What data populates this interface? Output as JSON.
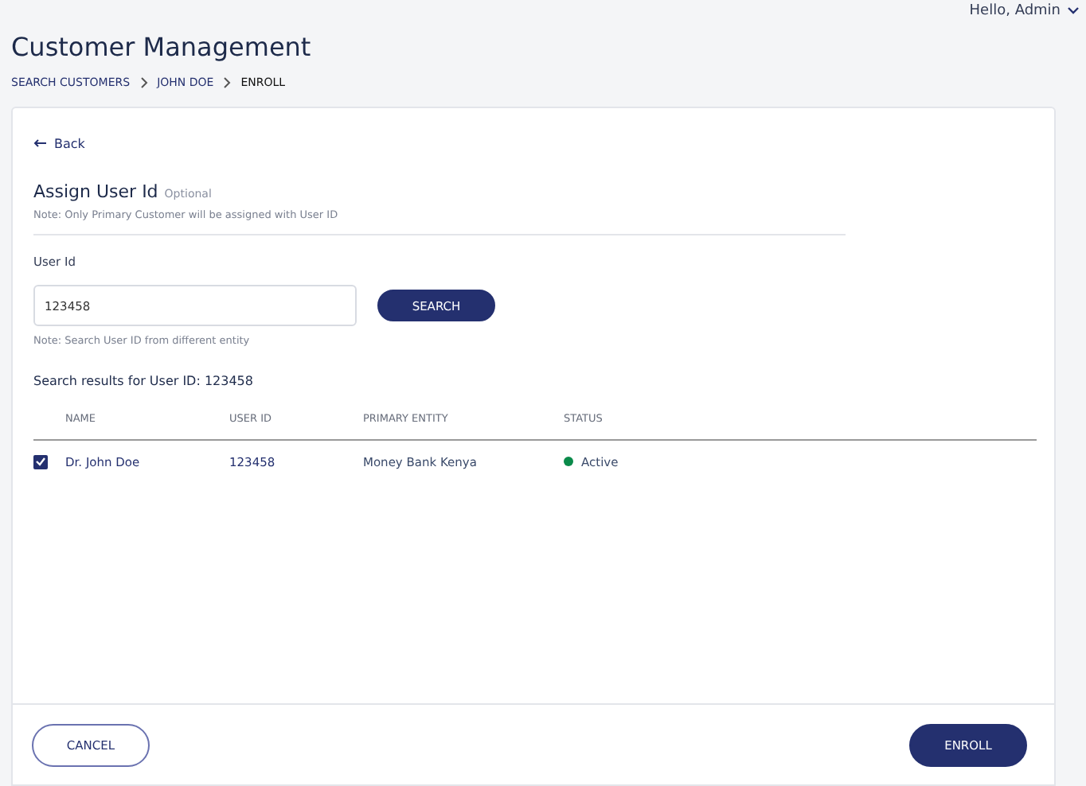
{
  "user_menu": {
    "greeting": "Hello, Admin"
  },
  "page_title": "Customer Management",
  "breadcrumb": [
    {
      "label": "SEARCH CUSTOMERS",
      "current": false
    },
    {
      "label": "JOHN DOE",
      "current": false
    },
    {
      "label": "ENROLL",
      "current": true
    }
  ],
  "back_link": "Back",
  "section": {
    "title": "Assign User Id",
    "tag": "Optional",
    "note": "Note: Only Primary Customer will be assigned with User ID"
  },
  "user_id_field": {
    "label": "User Id",
    "value": "123458",
    "note": "Note: Search User ID from different entity"
  },
  "search_button": "SEARCH",
  "results_title": "Search results for User ID: 123458",
  "table": {
    "columns": [
      "NAME",
      "USER ID",
      "PRIMARY ENTITY",
      "STATUS"
    ],
    "rows": [
      {
        "checked": true,
        "name": "Dr. John Doe",
        "user_id": "123458",
        "primary_entity": "Money Bank Kenya",
        "status": "Active",
        "color": "#0a8a4a"
      }
    ]
  },
  "footer": {
    "cancel": "CANCEL",
    "enroll": "ENROLL"
  }
}
